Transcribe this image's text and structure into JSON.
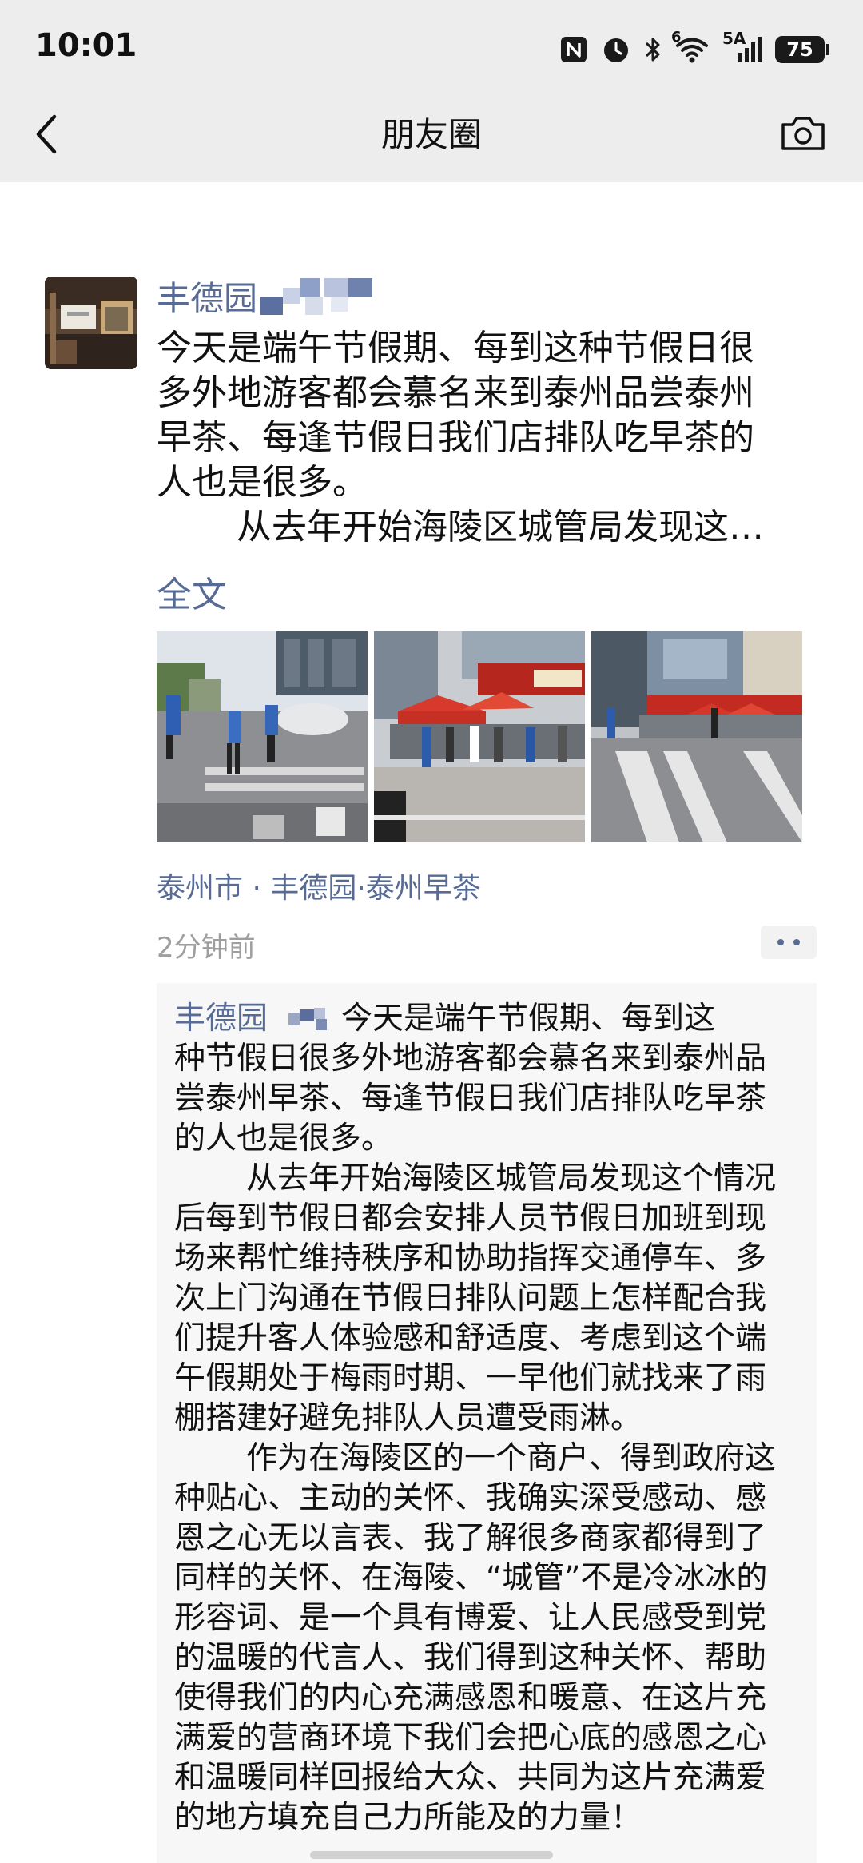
{
  "status_bar": {
    "time": "10:01",
    "network": "5A",
    "wifi_superscript": "6",
    "battery": "75",
    "icons": [
      "nfc-icon",
      "alarm-icon",
      "bluetooth-icon",
      "wifi-icon",
      "signal-icon",
      "battery-icon"
    ]
  },
  "nav": {
    "title": "朋友圈",
    "back_icon": "chevron-left-icon",
    "camera_icon": "camera-icon"
  },
  "post": {
    "author": "丰德园",
    "text_lines": [
      "今天是端午节假期、每到这种节假日很",
      "多外地游客都会慕名来到泰州品尝泰州",
      "早茶、每逢节假日我们店排队吃早茶的",
      "人也是很多。",
      "从去年开始海陵区城管局发现这…"
    ],
    "full_text_link": "全文",
    "photos": [
      "street-crossing-photo",
      "tent-queue-photo",
      "storefront-crosswalk-photo"
    ],
    "location": "泰州市 · 丰德园·泰州早茶",
    "time_ago": "2分钟前"
  },
  "comment": {
    "author": "丰德园",
    "lines": [
      "今天是端午节假期、每到这",
      "种节假日很多外地游客都会慕名来到泰州品",
      "尝泰州早茶、每逢节假日我们店排队吃早茶",
      "的人也是很多。",
      "从去年开始海陵区城管局发现这个情况",
      "后每到节假日都会安排人员节假日加班到现",
      "场来帮忙维持秩序和协助指挥交通停车、多",
      "次上门沟通在节假日排队问题上怎样配合我",
      "们提升客人体验感和舒适度、考虑到这个端",
      "午假期处于梅雨时期、一早他们就找来了雨",
      "棚搭建好避免排队人员遭受雨淋。",
      "作为在海陵区的一个商户、得到政府这",
      "种贴心、主动的关怀、我确实深受感动、感",
      "恩之心无以言表、我了解很多商家都得到了",
      "同样的关怀、在海陵、“城管”不是冷冰冰的",
      "形容词、是一个具有博爱、让人民感受到党",
      "的温暖的代言人、我们得到这种关怀、帮助",
      "使得我们的内心充满感恩和暖意、在这片充",
      "满爱的营商环境下我们会把心底的感恩之心",
      "和温暖同样回报给大众、共同为这片充满爱",
      "的地方填充自己力所能及的力量！"
    ]
  }
}
